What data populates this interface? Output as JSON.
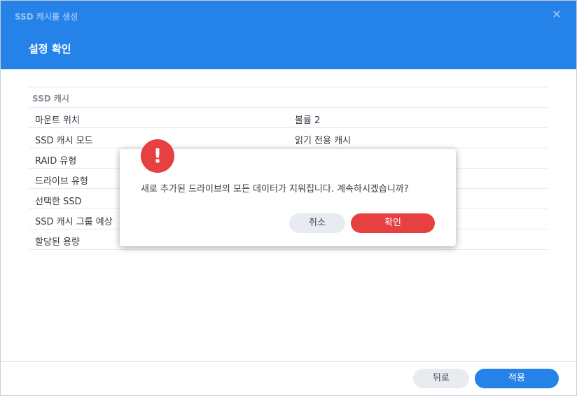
{
  "window": {
    "title": "SSD 캐시를 생성",
    "close_symbol": "✕",
    "step_title": "설정 확인"
  },
  "summary": {
    "section": "SSD 캐시",
    "rows": [
      {
        "label": "마운트 위치",
        "value": "볼륨 2"
      },
      {
        "label": "SSD 캐시 모드",
        "value": "읽기 전용 캐시"
      },
      {
        "label": "RAID 유형",
        "value": ""
      },
      {
        "label": "드라이브 유형",
        "value": ""
      },
      {
        "label": "선택한 SSD",
        "value": ""
      },
      {
        "label": "SSD 캐시 그룹 예상",
        "value": ""
      },
      {
        "label": "할당된 용량",
        "value": ""
      }
    ]
  },
  "footer": {
    "back_label": "뒤로",
    "apply_label": "적용"
  },
  "dialog": {
    "icon_symbol": "!",
    "message": "새로 추가된 드라이브의 모든 데이터가 지워집니다. 계속하시겠습니까?",
    "cancel_label": "취소",
    "confirm_label": "확인"
  },
  "colors": {
    "header": "#2582e8",
    "primary": "#2582e8",
    "danger": "#e64040"
  }
}
